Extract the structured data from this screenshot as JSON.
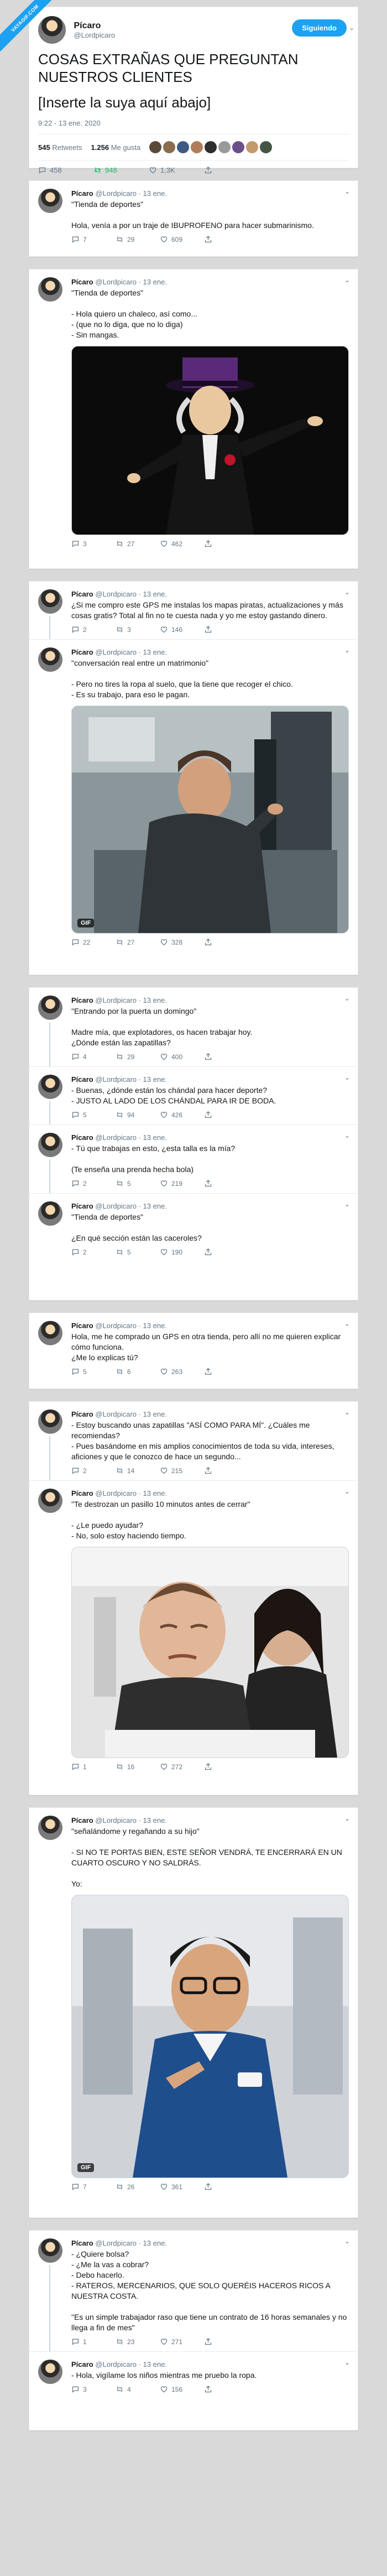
{
  "badge": "VAYAGIF.COM",
  "user": {
    "name": "Pícaro",
    "handle": "@Lordpicaro"
  },
  "main": {
    "follow": "Siguiendo",
    "title": "COSAS EXTRAÑAS QUE PREGUNTAN NUESTROS CLIENTES",
    "subtitle": "[Inserte la suya aquí abajo]",
    "date": "9:22 - 13 ene. 2020",
    "retweets_n": "545",
    "retweets_l": "Retweets",
    "likes_n": "1.256",
    "likes_l": "Me gusta",
    "reply": "458",
    "rt": "948",
    "like": "1,3K"
  },
  "reply_line": "@Lordpicaro · 13 ene.",
  "tweets": [
    {
      "text": "\"Tienda de deportes\"\n\nHola, venía a por un traje de IBUPROFENO para hacer submarinismo.",
      "r": "7",
      "t": "29",
      "l": "609"
    },
    {
      "text": "\"Tienda de deportes\"\n\n- Hola quiero un chaleco, así como...\n- (que no lo diga, que no lo diga)\n- Sin mangas.",
      "r": "3",
      "t": "27",
      "l": "462"
    },
    {
      "text": "¿Si me compro este GPS me instalas los mapas piratas, actualizaciones y más cosas gratis? Total al fin no te cuesta nada y yo me estoy gastando dinero.",
      "r": "2",
      "t": "3",
      "l": "146"
    },
    {
      "text": "\"conversación real entre un matrimonio\"\n\n- Pero no tires la ropa al suelo, que la tiene que recoger el chico.\n- Es su trabajo, para eso le pagan.",
      "r": "22",
      "t": "27",
      "l": "328"
    },
    {
      "text": "\"Entrando por la puerta un domingo\"\n\nMadre mía, que explotadores, os hacen trabajar hoy.\n¿Dónde están las zapatillas?",
      "r": "4",
      "t": "29",
      "l": "400"
    },
    {
      "text": "- Buenas, ¿dónde están los chándal para hacer deporte?\n- JUSTO AL LADO DE LOS CHÁNDAL PARA IR DE BODA.",
      "r": "5",
      "t": "94",
      "l": "426"
    },
    {
      "text": "- Tú que trabajas en esto, ¿esta talla es la mía?\n\n(Te enseña una prenda hecha bola)",
      "r": "2",
      "t": "5",
      "l": "219"
    },
    {
      "text": "\"Tienda de deportes\"\n\n¿En qué sección están las caceroles?",
      "r": "2",
      "t": "5",
      "l": "190"
    },
    {
      "text": "Hola, me he comprado un GPS en otra tienda, pero allí no me quieren explicar cómo funciona.\n¿Me lo explicas tú?",
      "r": "5",
      "t": "6",
      "l": "263"
    },
    {
      "text": "- Estoy buscando unas zapatillas \"ASÍ COMO PARA MÍ\". ¿Cuáles me recomiendas?\n- Pues basándome en mis amplios conocimientos de toda su vida, intereses, aficiones y que le conozco de hace un segundo...",
      "r": "2",
      "t": "14",
      "l": "215"
    },
    {
      "text": "\"Te destrozan un pasillo 10 minutos antes de cerrar\"\n\n- ¿Le puedo ayudar?\n- No, solo estoy haciendo tiempo.",
      "r": "1",
      "t": "16",
      "l": "272"
    },
    {
      "text": "\"señalándome y regañando a su hijo\"\n\n- SI NO TE PORTAS BIEN, ESTE SEÑOR VENDRÁ, TE ENCERRARÁ EN UN CUARTO OSCURO Y NO SALDRÁS.\n\nYo:",
      "r": "7",
      "t": "26",
      "l": "361"
    },
    {
      "text": "- ¿Quiere bolsa?\n- ¿Me la vas a cobrar?\n- Debo hacerlo.\n- RATEROS, MERCENARIOS, QUE SOLO QUERÉIS HACEROS RICOS A NUESTRA COSTA.\n\n\"Es un simple trabajador raso que tiene un contrato de 16 horas semanales y no llega a fin de mes\"",
      "r": "1",
      "t": "23",
      "l": "271"
    },
    {
      "text": "- Hola, vigílame los niños mientras me pruebo la ropa.",
      "r": "3",
      "t": "4",
      "l": "156"
    }
  ],
  "gif": "GIF",
  "colors": {
    "accent": "#1da1f2",
    "muted": "#657786",
    "background": "#d9d9d9"
  }
}
